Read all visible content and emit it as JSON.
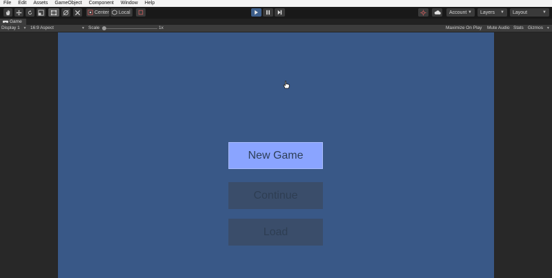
{
  "menu": [
    "File",
    "Edit",
    "Assets",
    "GameObject",
    "Component",
    "Window",
    "Help"
  ],
  "toolbar": {
    "center_label": "Center",
    "local_label": "Local",
    "account_label": "Account",
    "layers_label": "Layers",
    "layout_label": "Layout"
  },
  "tab": {
    "label": "Game"
  },
  "gamebar": {
    "display": "Display 1",
    "aspect": "16:9 Aspect",
    "scale_label": "Scale",
    "scale_value": "1x",
    "maximize": "Maximize On Play",
    "mute": "Mute Audio",
    "stats": "Stats",
    "gizmos": "Gizmos"
  },
  "game": {
    "buttons": {
      "new_game": "New Game",
      "continue": "Continue",
      "load": "Load"
    }
  },
  "colors": {
    "viewport_bg": "#395887",
    "primary_button": "#8aa4ff",
    "disabled_button": "#3a4d6a",
    "play_active": "#3d5e8a"
  }
}
